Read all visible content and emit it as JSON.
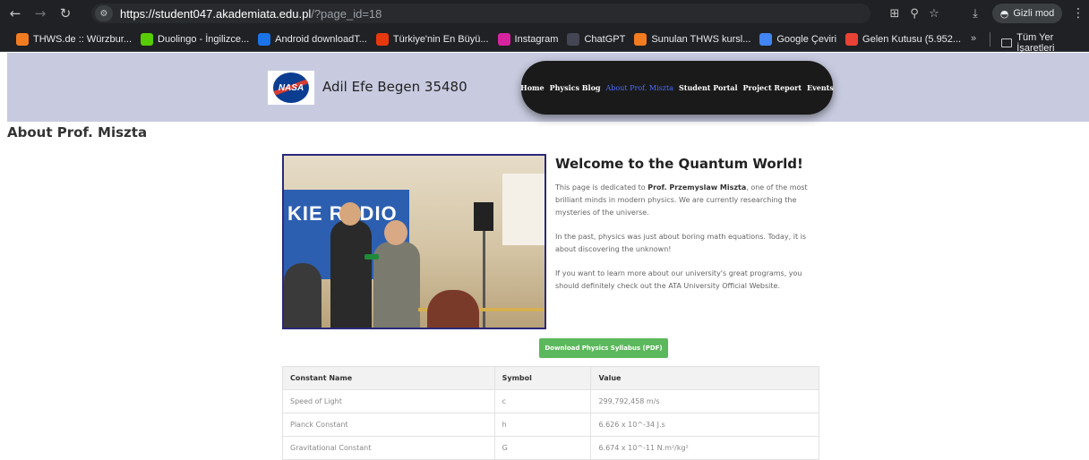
{
  "browser": {
    "url_host": "https://student047.akademiata.edu.pl",
    "url_path": "/?page_id=18",
    "incognito_label": "Gizli mod",
    "bookmarks": [
      {
        "label": "THWS.de :: Würzbur...",
        "color": "#f47c20",
        "icon": "thws-favicon"
      },
      {
        "label": "Duolingo - İngilizce...",
        "color": "#58cc02",
        "icon": "duolingo-favicon"
      },
      {
        "label": "Android downloadT...",
        "color": "#1a73e8",
        "icon": "android-download-favicon"
      },
      {
        "label": "Türkiye'nin En Büyü...",
        "color": "#e8380d",
        "icon": "hb-favicon"
      },
      {
        "label": "Instagram",
        "color": "#d6249f",
        "icon": "instagram-favicon"
      },
      {
        "label": "ChatGPT",
        "color": "#444654",
        "icon": "chatgpt-favicon"
      },
      {
        "label": "Sunulan THWS kursl...",
        "color": "#f47c20",
        "icon": "thws-favicon"
      },
      {
        "label": "Google Çeviri",
        "color": "#4285f4",
        "icon": "google-translate-favicon"
      },
      {
        "label": "Gelen Kutusu (5.952...",
        "color": "#ea4335",
        "icon": "gmail-favicon"
      }
    ],
    "bookmarks_more": "»",
    "all_bookmarks_label": "Tüm Yer İşaretleri"
  },
  "site": {
    "logo_text": "NASA",
    "title": "Adil Efe Begen 35480",
    "nav": [
      {
        "label": "Home",
        "active": false
      },
      {
        "label": "Physics Blog",
        "active": false
      },
      {
        "label": "About Prof. Miszta",
        "active": true
      },
      {
        "label": "Student Portal",
        "active": false
      },
      {
        "label": "Project Report",
        "active": false
      },
      {
        "label": "Events",
        "active": false
      }
    ],
    "active_color": "#4a6cff"
  },
  "page": {
    "heading": "About Prof. Miszta",
    "photo_banner_text": "KIE RADIO",
    "welcome_title": "Welcome to the Quantum World!",
    "para1_pre": "This page is dedicated to ",
    "para1_bold": "Prof. Przemyslaw Miszta",
    "para1_post": ", one of the most brilliant minds in modern physics. We are currently researching the mysteries of the universe.",
    "para2": "In the past, physics was just about boring math equations. Today, it is about discovering the unknown!",
    "para3": "If you want to learn more about our university's great programs, you should definitely check out the ATA University Official Website.",
    "download_label": "Download Physics Syllabus (PDF)",
    "button_color": "#5cb85c"
  },
  "table": {
    "headers": [
      "Constant Name",
      "Symbol",
      "Value"
    ],
    "rows": [
      [
        "Speed of Light",
        "c",
        "299,792,458 m/s"
      ],
      [
        "Planck Constant",
        "h",
        "6.626 x 10^-34 J.s"
      ],
      [
        "Gravitational Constant",
        "G",
        "6.674 x 10^-11 N.m²/kg²"
      ]
    ]
  }
}
